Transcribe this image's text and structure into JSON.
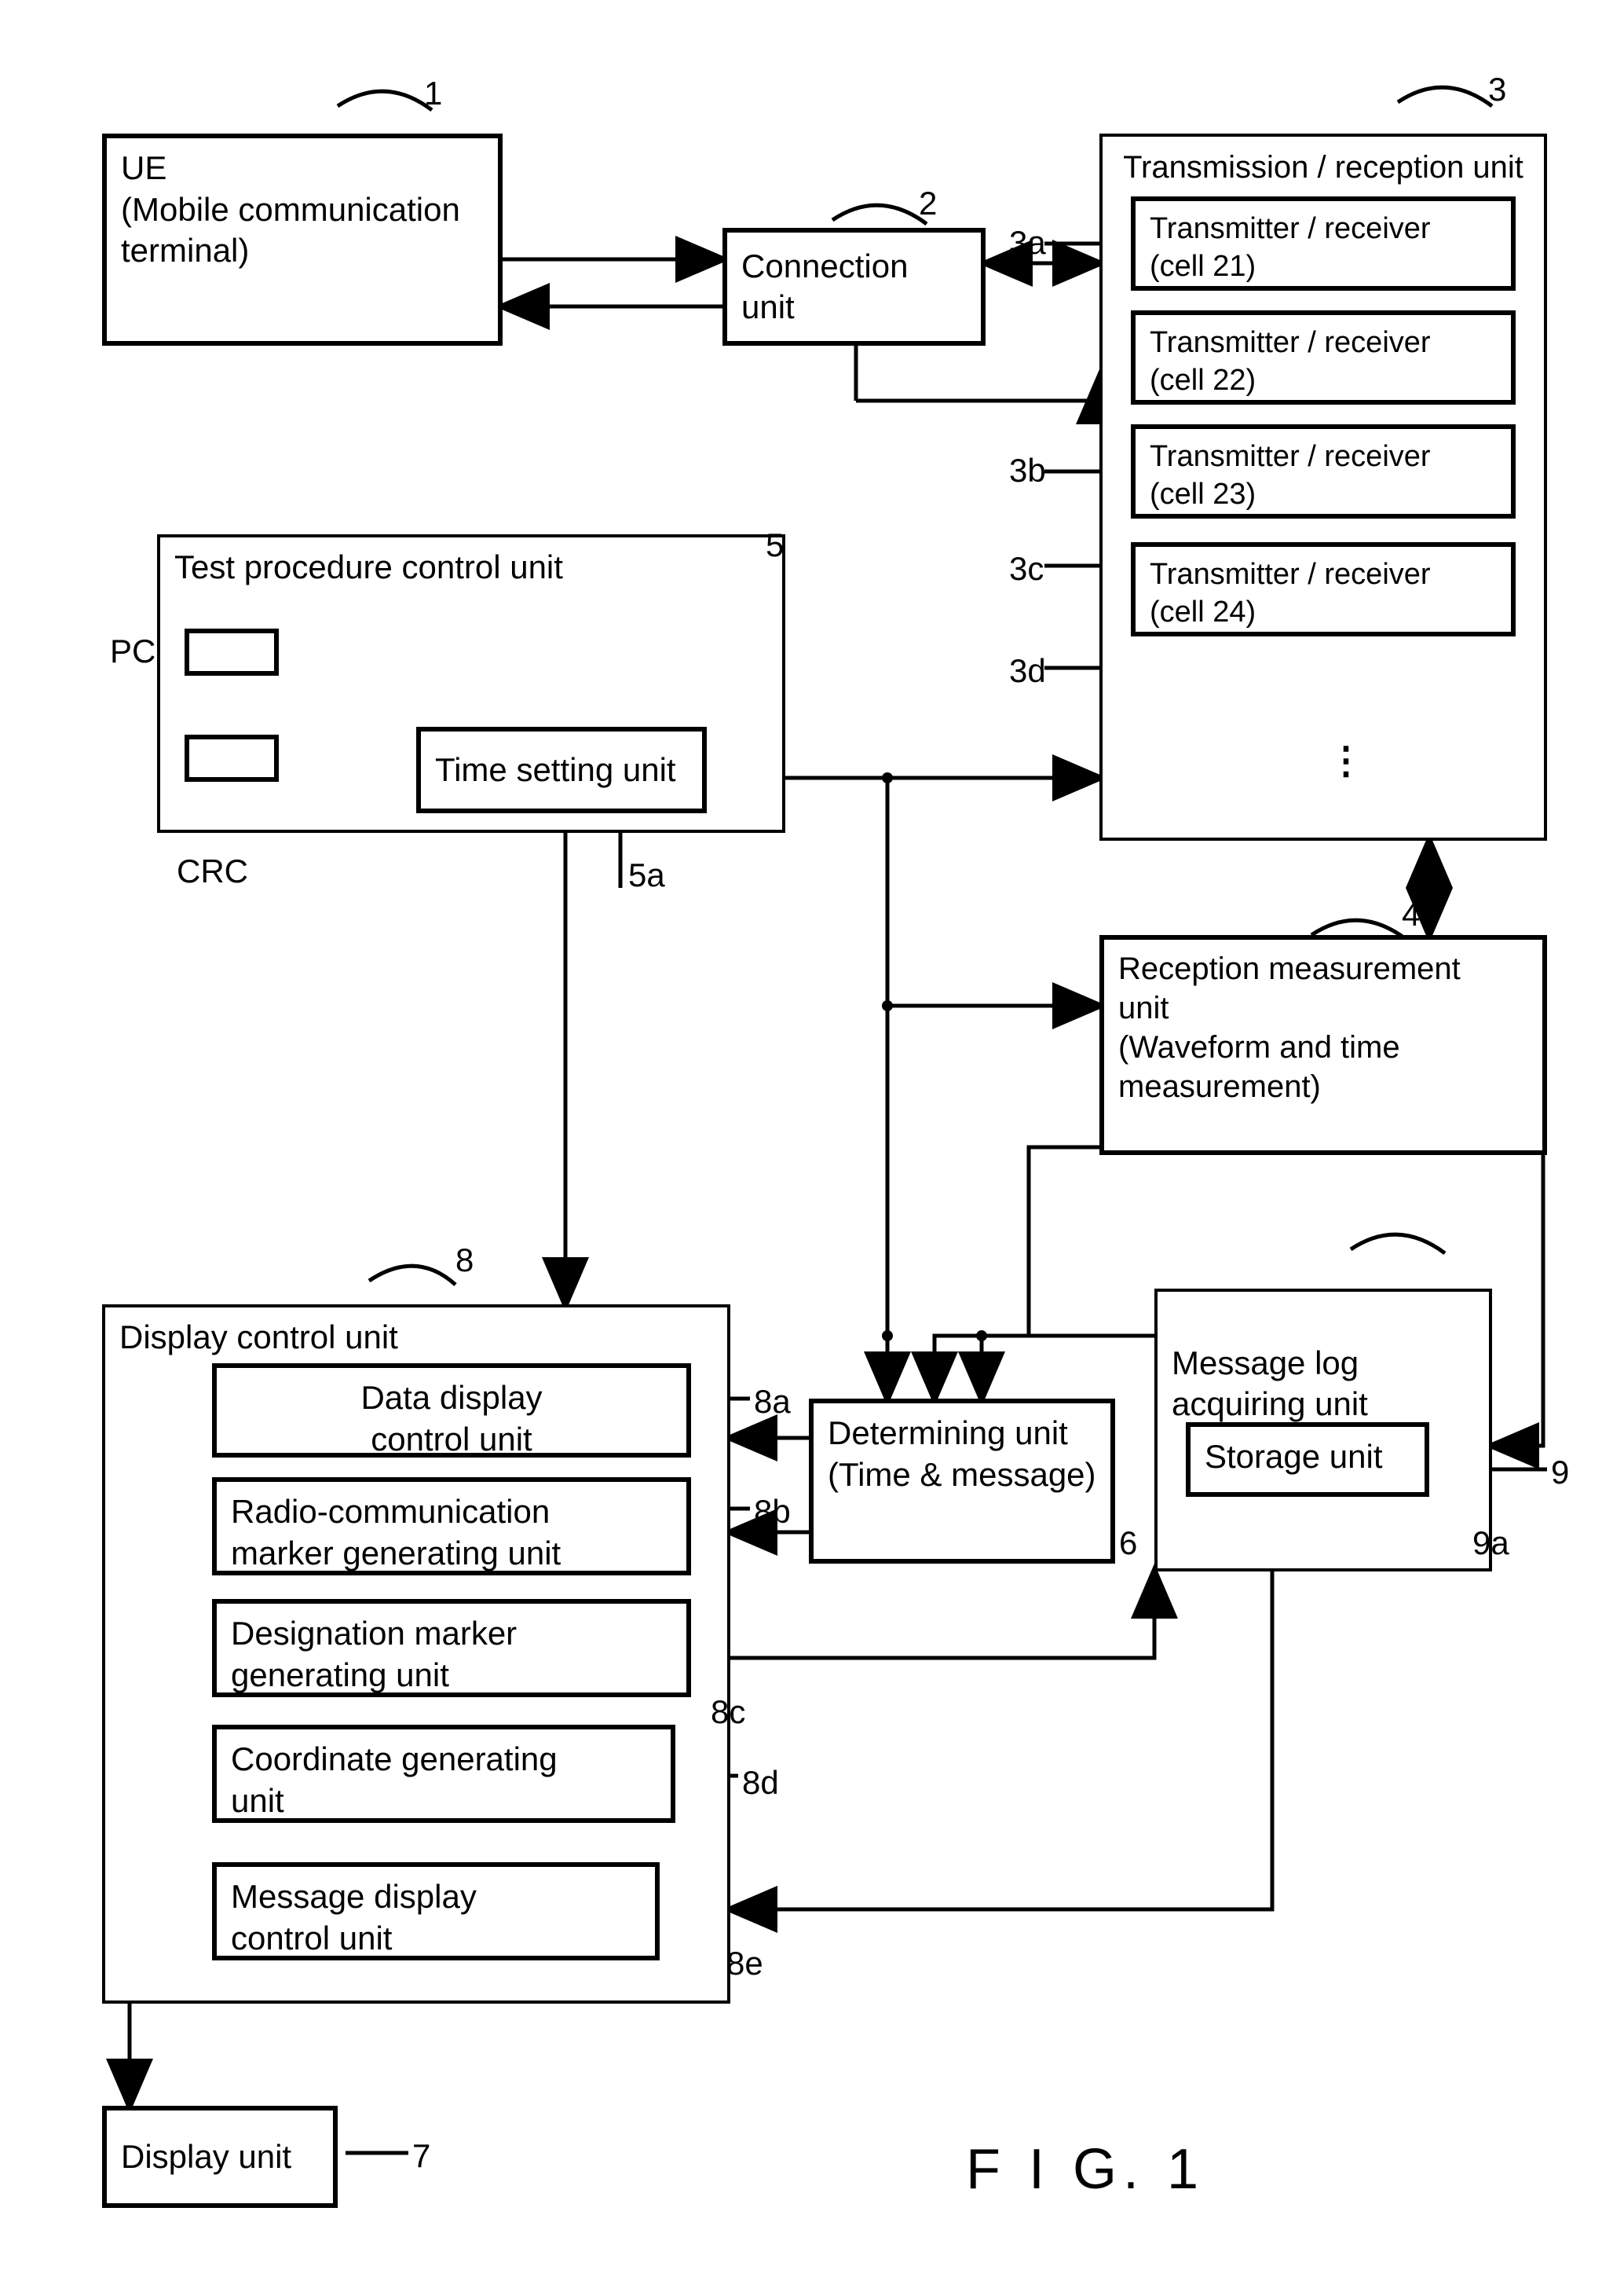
{
  "figure_label": "F I G. 1",
  "blocks": {
    "ue": {
      "ref": "1",
      "text": "UE\n(Mobile communication\nterminal)"
    },
    "conn": {
      "ref": "2",
      "text": "Connection unit"
    },
    "tx_unit": {
      "ref": "3",
      "text": "Transmission / reception  unit"
    },
    "tx_a": {
      "ref": "3a",
      "text": "Transmitter / receiver\n(cell  21)"
    },
    "tx_b": {
      "ref": "3b",
      "text": "Transmitter / receiver\n(cell  22)"
    },
    "tx_c": {
      "ref": "3c",
      "text": "Transmitter / receiver\n(cell  23)"
    },
    "tx_d": {
      "ref": "3d",
      "text": "Transmitter / receiver\n(cell  24)"
    },
    "rxmeas": {
      "ref": "4",
      "text": "Reception measurement\nunit\n(Waveform and time\nmeasurement)"
    },
    "tpc": {
      "ref": "5",
      "text": "Test procedure control unit"
    },
    "timeset": {
      "ref": "5a",
      "text": "Time setting unit"
    },
    "pc": {
      "text": "PC"
    },
    "crc": {
      "text": "CRC"
    },
    "det": {
      "ref": "6",
      "text": "Determining unit\n(Time & message)"
    },
    "display": {
      "ref": "7",
      "text": "Display unit"
    },
    "dcu": {
      "ref": "8",
      "text": "Display control unit"
    },
    "dcu_a": {
      "ref": "8a",
      "text": "Data display\ncontrol unit"
    },
    "dcu_b": {
      "ref": "8b",
      "text": "Radio-communication\nmarker generating unit"
    },
    "dcu_c": {
      "ref": "8c",
      "text": "Designation marker\ngenerating unit"
    },
    "dcu_d": {
      "ref": "8d",
      "text": "Coordinate generating\nunit"
    },
    "dcu_e": {
      "ref": "8e",
      "text": "Message display\ncontrol unit"
    },
    "mlog": {
      "ref": "9",
      "text": "Message log\nacquiring unit"
    },
    "storage": {
      "ref": "9a",
      "text": "Storage unit"
    }
  }
}
